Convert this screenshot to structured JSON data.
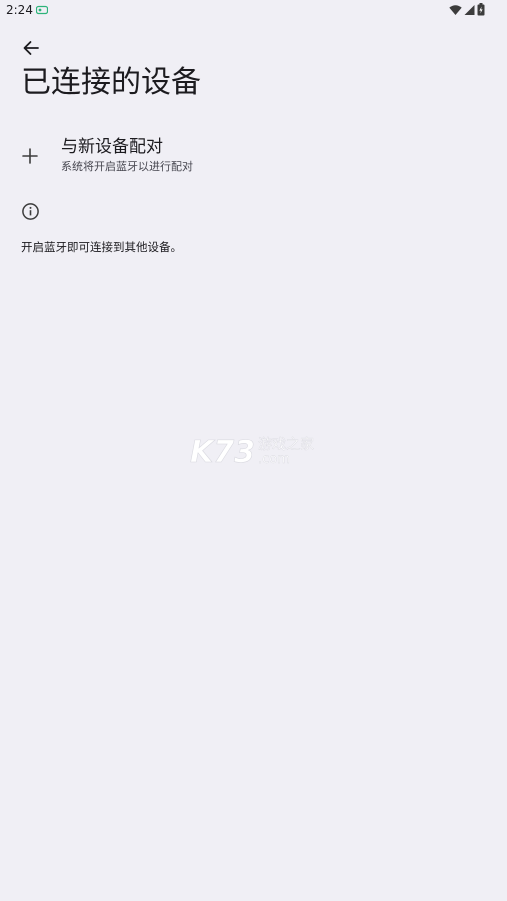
{
  "status_bar": {
    "time": "2:24",
    "app_icon": "app-notification-icon",
    "icons": [
      "wifi-icon",
      "cell-signal-icon",
      "battery-icon"
    ]
  },
  "toolbar": {
    "back_icon": "back-arrow-icon",
    "title": "已连接的设备"
  },
  "pair_new": {
    "icon": "plus-icon",
    "title": "与新设备配对",
    "summary": "系统将开启蓝牙以进行配对"
  },
  "info": {
    "icon": "info-icon",
    "text": "开启蓝牙即可连接到其他设备。"
  },
  "watermark": {
    "logo": "K73",
    "line1": "游戏之家",
    "line2": ".com"
  },
  "colors": {
    "background": "#f0eff5",
    "text_primary": "#1c1b1f",
    "text_secondary": "#46464f",
    "watermark": "#ffffff"
  }
}
